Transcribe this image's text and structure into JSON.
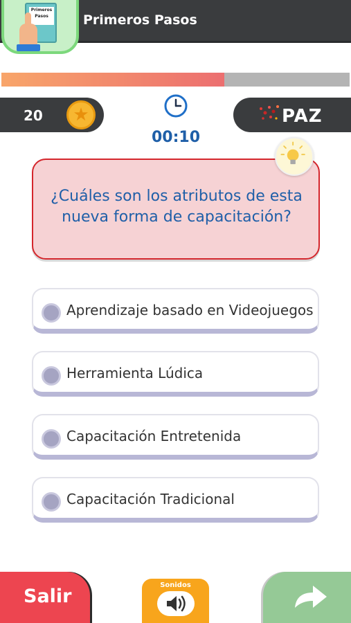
{
  "header": {
    "title": "Primeros Pasos",
    "logo_label": "Primeros Pasos"
  },
  "progress": {
    "fraction": 0.64,
    "fill_colors": [
      "#f8a56a",
      "#ec6f70"
    ],
    "track_color": "#b4b4b4"
  },
  "score": {
    "value": "20",
    "icon": "star-coin-icon"
  },
  "timer": {
    "icon": "clock-icon",
    "value": "00:10"
  },
  "brand": {
    "text": "PAZ"
  },
  "question": {
    "text": "¿Cuáles son los atributos de esta nueva forma de capacitación?",
    "hint_icon": "lightbulb-icon"
  },
  "options": [
    {
      "label": "Aprendizaje basado en Videojuegos"
    },
    {
      "label": "Herramienta Lúdica"
    },
    {
      "label": "Capacitación Entretenida"
    },
    {
      "label": "Capacitación Tradicional"
    }
  ],
  "footer": {
    "exit_label": "Salir",
    "sound_label": "Sonidos",
    "sound_icon": "speaker-icon",
    "next_icon": "arrow-right-icon"
  },
  "colors": {
    "header_bg": "#3a3c3e",
    "question_bg": "#f6d2d4",
    "question_border": "#d4262c",
    "question_text": "#1f5fa8",
    "exit_bg": "#ed4550",
    "sound_bg": "#f8a51c",
    "next_bg": "#95c996"
  }
}
